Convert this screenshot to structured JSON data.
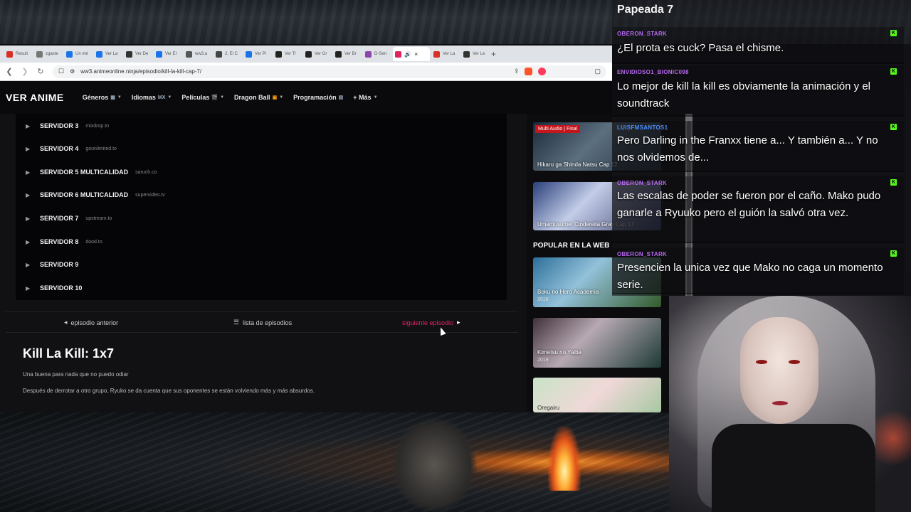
{
  "browser": {
    "tabs": [
      {
        "label": "Result",
        "color": "#d93025"
      },
      {
        "label": "zgaste",
        "color": "#777777"
      },
      {
        "label": "Un mé",
        "color": "#1a73e8"
      },
      {
        "label": "Ver La",
        "color": "#1a73e8"
      },
      {
        "label": "Ver De",
        "color": "#333333"
      },
      {
        "label": "Ver El",
        "color": "#1a73e8"
      },
      {
        "label": "ww3.a",
        "color": "#555555"
      },
      {
        "label": "2. El C",
        "color": "#444444"
      },
      {
        "label": "Ver Pi",
        "color": "#1a73e8"
      },
      {
        "label": "Ver Tr",
        "color": "#222222"
      },
      {
        "label": "Ver Gr",
        "color": "#222222"
      },
      {
        "label": "Ver Br",
        "color": "#222222"
      },
      {
        "label": "D-Sen",
        "color": "#8e44ad"
      },
      {
        "label": "",
        "color": "#e0245e",
        "active": true
      },
      {
        "label": "Ver La",
        "color": "#d93025"
      },
      {
        "label": "Ver Le",
        "color": "#333333"
      }
    ],
    "new_tab": "+",
    "url": "ww3.animeonline.ninja/episodio/kill-la-kill-cap-7/"
  },
  "site": {
    "logo": "VER ANIME",
    "menu": [
      {
        "label": "Géneros",
        "tag": "▦"
      },
      {
        "label": "Idiomas",
        "tag": "MX"
      },
      {
        "label": "Películas",
        "tag": "🎬"
      },
      {
        "label": "Dragon Ball",
        "tag": "▣"
      },
      {
        "label": "Programación",
        "tag": "▤"
      },
      {
        "label": "+ Más",
        "tag": ""
      }
    ]
  },
  "servers": [
    {
      "name": "SERVIDOR 3",
      "host": "mixdrop.to"
    },
    {
      "name": "SERVIDOR 4",
      "host": "gounlimited.to"
    },
    {
      "name": "SERVIDOR 5 MULTICALIDAD",
      "host": "saruch.co"
    },
    {
      "name": "SERVIDOR 6 MULTICALIDAD",
      "host": "supervideo.tv"
    },
    {
      "name": "SERVIDOR 7",
      "host": "upstream.to"
    },
    {
      "name": "SERVIDOR 8",
      "host": "dood.to"
    },
    {
      "name": "SERVIDOR 9",
      "host": ""
    },
    {
      "name": "SERVIDOR 10",
      "host": ""
    }
  ],
  "episode_nav": {
    "prev": "episodio anterior",
    "list": "lista de episodios",
    "next": "siguiente episodio"
  },
  "episode": {
    "title": "Kill La Kill: 1x7",
    "subtitle": "Una buena para nada que no puedo odiar",
    "description": "Después de derrotar a otro grupo, Ryuko se da cuenta que sus oponentes se están volviendo más y más absurdos."
  },
  "sidebar": {
    "cards": [
      {
        "badge": "Multi Audio | Final",
        "title": "Hikaru ga Shinda Natsu Cap 12",
        "year": ""
      },
      {
        "badge": "",
        "title": "Umamusume: Cinderella Gray Cap 17",
        "year": ""
      }
    ],
    "popular_heading": "POPULAR EN LA WEB",
    "popular": [
      {
        "title": "Boku no Hero Academia",
        "year": "2016"
      },
      {
        "title": "Kimetsu no Yaiba",
        "year": "2019"
      },
      {
        "title": "Oregairu",
        "year": ""
      }
    ]
  },
  "chat": {
    "title": "Papeada 7",
    "messages": [
      {
        "user": "OBERON_STARK",
        "text": "¿El prota es cuck? Pasa el chisme."
      },
      {
        "user": "ENVIDIOSO1_BIONIC098",
        "text": "Lo mejor de kill la kill es obviamente la animación y el soundtrack"
      },
      {
        "user": "LUISFMSANTOS1",
        "text": "Pero Darling in the Franxx tiene a... Y también a... Y no nos olvidemos de..."
      },
      {
        "user": "OBERON_STARK",
        "text": "Las escalas de poder se fueron por el caño. Mako pudo ganarle a Ryuuko pero el guión la salvó otra vez."
      },
      {
        "user": "OBERON_STARK",
        "text": "Presencien la unica vez que Mako no caga un momento serie."
      }
    ],
    "badge_icon": "K"
  }
}
